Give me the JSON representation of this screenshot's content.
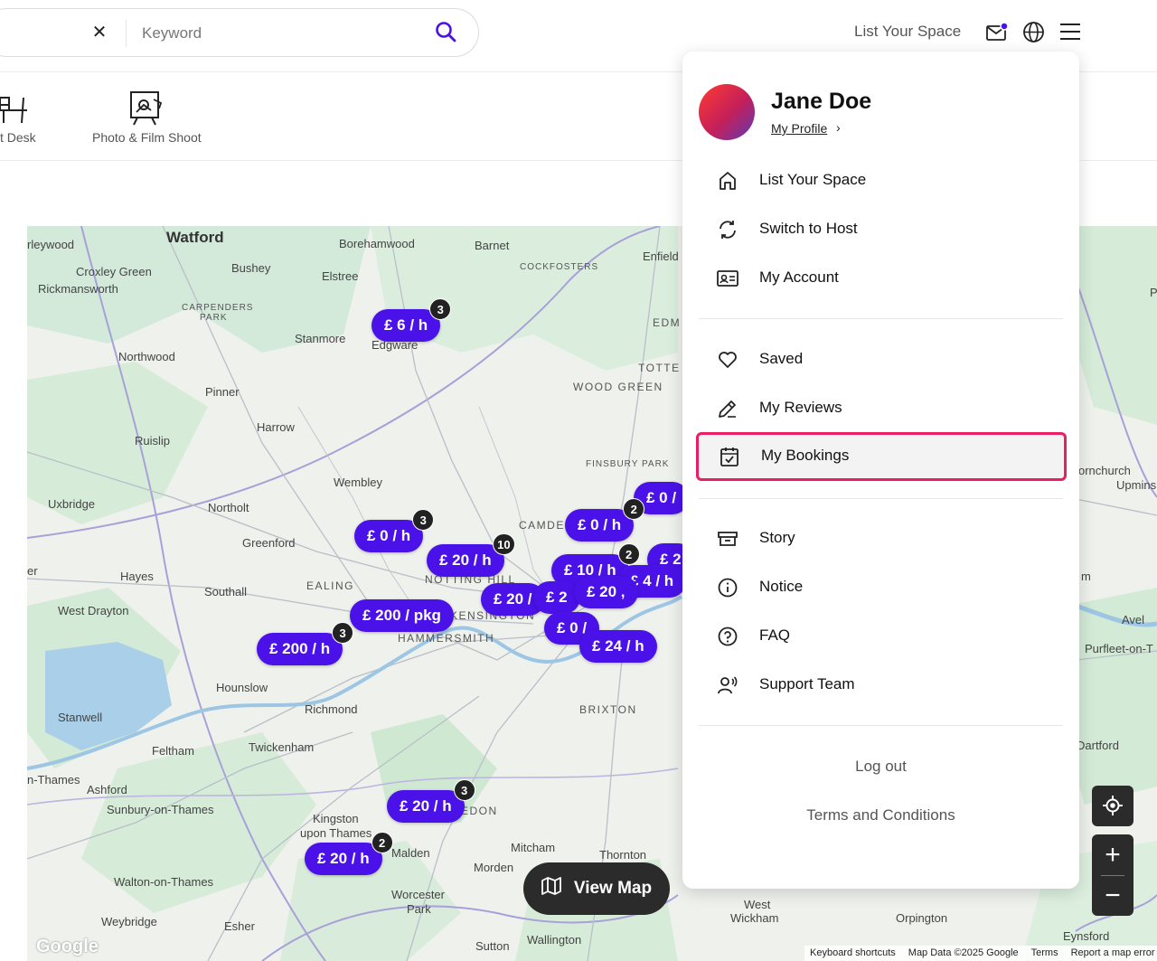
{
  "header": {
    "search_placeholder": "Keyword",
    "search_clear": "✕",
    "list_space": "List Your Space"
  },
  "categories": [
    {
      "label": "t Desk",
      "icon": "desk-icon"
    },
    {
      "label": "Photo & Film Shoot",
      "icon": "camera-easel-icon"
    }
  ],
  "map": {
    "places": [
      {
        "name": "Watford",
        "style": "big"
      },
      {
        "name": "rleywood",
        "style": "normal"
      },
      {
        "name": "Borehamwood",
        "style": "normal"
      },
      {
        "name": "Barnet",
        "style": "normal"
      },
      {
        "name": "Enfield",
        "style": "normal"
      },
      {
        "name": "Croxley Green",
        "style": "normal"
      },
      {
        "name": "Bushey",
        "style": "normal"
      },
      {
        "name": "Elstree",
        "style": "normal"
      },
      {
        "name": "COCKFOSTERS",
        "style": "caps-s"
      },
      {
        "name": "Rickmansworth",
        "style": "normal"
      },
      {
        "name": "CARPENDERS",
        "style": "caps-s"
      },
      {
        "name": "PARK",
        "style": "caps-s"
      },
      {
        "name": "Stanmore",
        "style": "normal"
      },
      {
        "name": "Edgware",
        "style": "normal"
      },
      {
        "name": "EDM",
        "style": "caps"
      },
      {
        "name": "Northwood",
        "style": "normal"
      },
      {
        "name": "TOTTE",
        "style": "caps"
      },
      {
        "name": "Pinner",
        "style": "normal"
      },
      {
        "name": "WOOD GREEN",
        "style": "caps"
      },
      {
        "name": "Harrow",
        "style": "normal"
      },
      {
        "name": "Ruislip",
        "style": "normal"
      },
      {
        "name": "FINSBURY PARK",
        "style": "caps-s"
      },
      {
        "name": "Wembley",
        "style": "normal"
      },
      {
        "name": "Uxbridge",
        "style": "normal"
      },
      {
        "name": "Northolt",
        "style": "normal"
      },
      {
        "name": "CAMDE",
        "style": "caps"
      },
      {
        "name": "Greenford",
        "style": "normal"
      },
      {
        "name": "NOTTING HILL",
        "style": "caps"
      },
      {
        "name": "er",
        "style": "normal"
      },
      {
        "name": "Hayes",
        "style": "normal"
      },
      {
        "name": "EALING",
        "style": "caps"
      },
      {
        "name": "Southall",
        "style": "normal"
      },
      {
        "name": "KENSINGTON",
        "style": "caps"
      },
      {
        "name": "West Drayton",
        "style": "normal"
      },
      {
        "name": "HAMMERSMITH",
        "style": "caps"
      },
      {
        "name": "Hounslow",
        "style": "normal"
      },
      {
        "name": "Richmond",
        "style": "normal"
      },
      {
        "name": "BRIXTON",
        "style": "caps"
      },
      {
        "name": "Stanwell",
        "style": "normal"
      },
      {
        "name": "Feltham",
        "style": "normal"
      },
      {
        "name": "Twickenham",
        "style": "normal"
      },
      {
        "name": "n-Thames",
        "style": "normal"
      },
      {
        "name": "Ashford",
        "style": "normal"
      },
      {
        "name": "Sunbury-on-Thames",
        "style": "normal"
      },
      {
        "name": "Kingston",
        "style": "normal"
      },
      {
        "name": "upon Thames",
        "style": "normal"
      },
      {
        "name": "EDON",
        "style": "caps"
      },
      {
        "name": "Malden",
        "style": "normal"
      },
      {
        "name": "Mitcham",
        "style": "normal"
      },
      {
        "name": "Thornton",
        "style": "normal"
      },
      {
        "name": "Morden",
        "style": "normal"
      },
      {
        "name": "Walton-on-Thames",
        "style": "normal"
      },
      {
        "name": "Worcester",
        "style": "normal"
      },
      {
        "name": "Park",
        "style": "normal"
      },
      {
        "name": "Weybridge",
        "style": "normal"
      },
      {
        "name": "Esher",
        "style": "normal"
      },
      {
        "name": "Sutton",
        "style": "normal"
      },
      {
        "name": "Wallington",
        "style": "normal"
      },
      {
        "name": "West",
        "style": "normal"
      },
      {
        "name": "Wickham",
        "style": "normal"
      },
      {
        "name": "Orpington",
        "style": "normal"
      },
      {
        "name": "Eynsford",
        "style": "normal"
      },
      {
        "name": "ornchurch",
        "style": "normal"
      },
      {
        "name": "Upmins",
        "style": "normal"
      },
      {
        "name": "m",
        "style": "normal"
      },
      {
        "name": "Avel",
        "style": "normal"
      },
      {
        "name": "Purfleet-on-T",
        "style": "normal"
      },
      {
        "name": "Dartford",
        "style": "normal"
      },
      {
        "name": "P",
        "style": "normal"
      }
    ],
    "pins": [
      {
        "price": "£ 6 / h",
        "count": "3"
      },
      {
        "price": "£ 0 /",
        "count": ""
      },
      {
        "price": "£ 0 / h",
        "count": "2"
      },
      {
        "price": "£ 0 / h",
        "count": "3"
      },
      {
        "price": "£ 20 / h",
        "count": "10"
      },
      {
        "price": "£ 2",
        "count": ""
      },
      {
        "price": "£ 10 / h",
        "count": "2"
      },
      {
        "price": "£ 4 / h",
        "count": ""
      },
      {
        "price": "£ 20 /",
        "count": ""
      },
      {
        "price": "£ 2",
        "count": ""
      },
      {
        "price": "£ 20 ,",
        "count": ""
      },
      {
        "price": "£ 200 / pkg",
        "count": ""
      },
      {
        "price": "£ 0 /",
        "count": ""
      },
      {
        "price": "£ 24 / h",
        "count": ""
      },
      {
        "price": "£ 200 / h",
        "count": "3"
      },
      {
        "price": "£ 20 / h",
        "count": "3"
      },
      {
        "price": "£ 20 / h",
        "count": "2"
      }
    ],
    "view_map": "View Map",
    "zoom_in": "+",
    "zoom_out": "−",
    "google": "Google",
    "attribution": [
      "Keyboard shortcuts",
      "Map Data ©2025 Google",
      "Terms",
      "Report a map error"
    ]
  },
  "dropdown": {
    "user_name": "Jane Doe",
    "profile_link": "My Profile",
    "profile_chevron": "›",
    "section1": [
      {
        "label": "List Your Space",
        "icon": "home-icon"
      },
      {
        "label": "Switch to Host",
        "icon": "switch-icon"
      },
      {
        "label": "My Account",
        "icon": "id-card-icon"
      }
    ],
    "section2": [
      {
        "label": "Saved",
        "icon": "heart-icon"
      },
      {
        "label": "My Reviews",
        "icon": "pencil-icon"
      },
      {
        "label": "My Bookings",
        "icon": "calendar-check-icon"
      }
    ],
    "section3": [
      {
        "label": "Story",
        "icon": "archive-icon"
      },
      {
        "label": "Notice",
        "icon": "info-icon"
      },
      {
        "label": "FAQ",
        "icon": "question-icon"
      },
      {
        "label": "Support Team",
        "icon": "support-icon"
      }
    ],
    "logout": "Log out",
    "terms": "Terms and Conditions",
    "highlight_color": "#e91e63"
  },
  "colors": {
    "accent": "#4a12e8",
    "pin_badge": "#222222",
    "map_green": "#cfe8d2",
    "water": "#aacfe8"
  }
}
